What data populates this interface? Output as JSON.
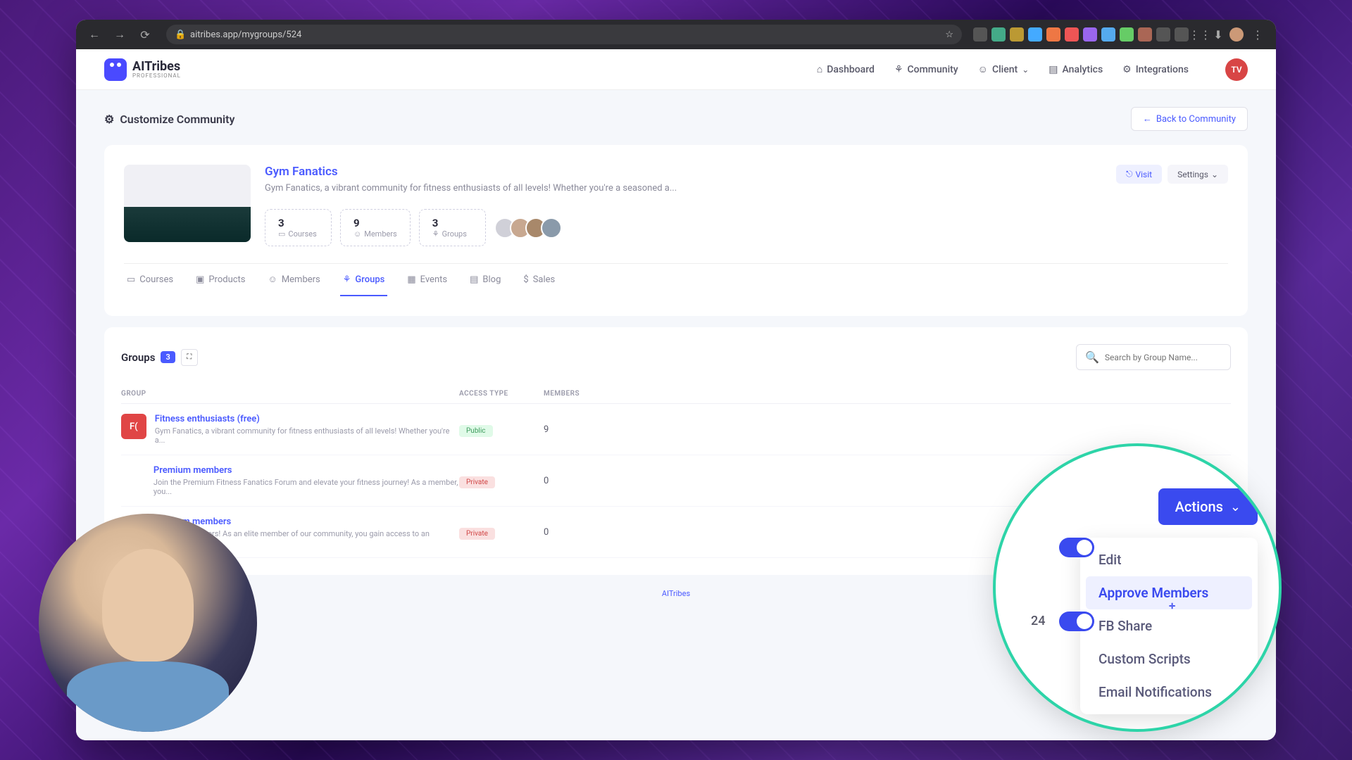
{
  "browser": {
    "url": "aitribes.app/mygroups/524"
  },
  "logo": {
    "name": "AITribes",
    "sub": "PROFESSIONAL"
  },
  "nav": {
    "dashboard": "Dashboard",
    "community": "Community",
    "client": "Client",
    "analytics": "Analytics",
    "integrations": "Integrations",
    "avatar": "TV"
  },
  "page": {
    "title": "Customize Community",
    "back": "Back to Community"
  },
  "community": {
    "name": "Gym Fanatics",
    "desc": "Gym Fanatics, a vibrant community for fitness enthusiasts of all levels! Whether you're a seasoned a...",
    "visit": "Visit",
    "settings": "Settings",
    "stats": [
      {
        "num": "3",
        "label": "Courses"
      },
      {
        "num": "9",
        "label": "Members"
      },
      {
        "num": "3",
        "label": "Groups"
      }
    ]
  },
  "tabs": {
    "courses": "Courses",
    "products": "Products",
    "members": "Members",
    "groups": "Groups",
    "events": "Events",
    "blog": "Blog",
    "sales": "Sales"
  },
  "groups": {
    "title": "Groups",
    "count": "3",
    "search_placeholder": "Search by Group Name...",
    "columns": {
      "group": "GROUP",
      "access": "ACCESS TYPE",
      "members": "MEMBERS"
    },
    "rows": [
      {
        "thumb": "F(",
        "name": "Fitness enthusiasts (free)",
        "desc": "Gym Fanatics, a vibrant community for fitness enthusiasts of all levels! Whether you're a...",
        "access": "Public",
        "access_class": "public",
        "members": "9"
      },
      {
        "thumb": "",
        "name": "Premium members",
        "desc": "Join the Premium Fitness Fanatics Forum and elevate your fitness journey! As a member, you...",
        "access": "Private",
        "access_class": "private",
        "members": "0"
      },
      {
        "thumb": "",
        "name": "Platinum members",
        "desc": "Platinum Members! As an elite member of our community, you gain access to an exclusive set...",
        "access": "Private",
        "access_class": "private",
        "members": "0"
      }
    ]
  },
  "footer": {
    "brand": "AITribes"
  },
  "zoom": {
    "actions": "Actions",
    "num": "24",
    "menu": {
      "edit": "Edit",
      "approve": "Approve Members",
      "fbshare": "FB Share",
      "scripts": "Custom Scripts",
      "email": "Email Notifications"
    }
  }
}
